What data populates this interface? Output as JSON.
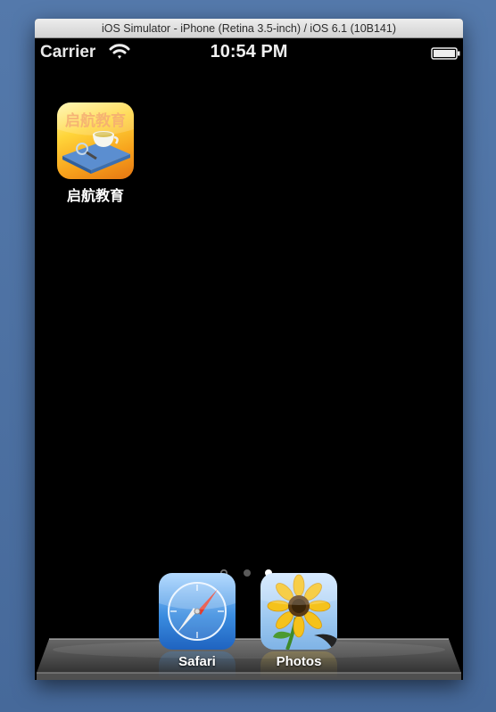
{
  "window": {
    "title": "iOS Simulator - iPhone (Retina 3.5-inch) / iOS 6.1 (10B141)"
  },
  "statusbar": {
    "carrier": "Carrier",
    "time": "10:54 PM",
    "icons": [
      "wifi-icon",
      "battery-icon"
    ]
  },
  "home": {
    "apps": [
      {
        "label": "启航教育",
        "icon_text": "启航教育",
        "icon": "qihang-education-app-icon"
      }
    ],
    "page_indicator": {
      "pages": 2,
      "current": 2,
      "has_search_page": true
    }
  },
  "dock": {
    "apps": [
      {
        "label": "Safari",
        "icon": "safari-compass-icon"
      },
      {
        "label": "Photos",
        "icon": "photos-sunflower-icon"
      }
    ]
  },
  "colors": {
    "desktop": "#4a6fa0",
    "screen": "#000000",
    "text": "#ffffff",
    "dot_active": "#ffffff",
    "dot_inactive": "#5a5a5a"
  }
}
